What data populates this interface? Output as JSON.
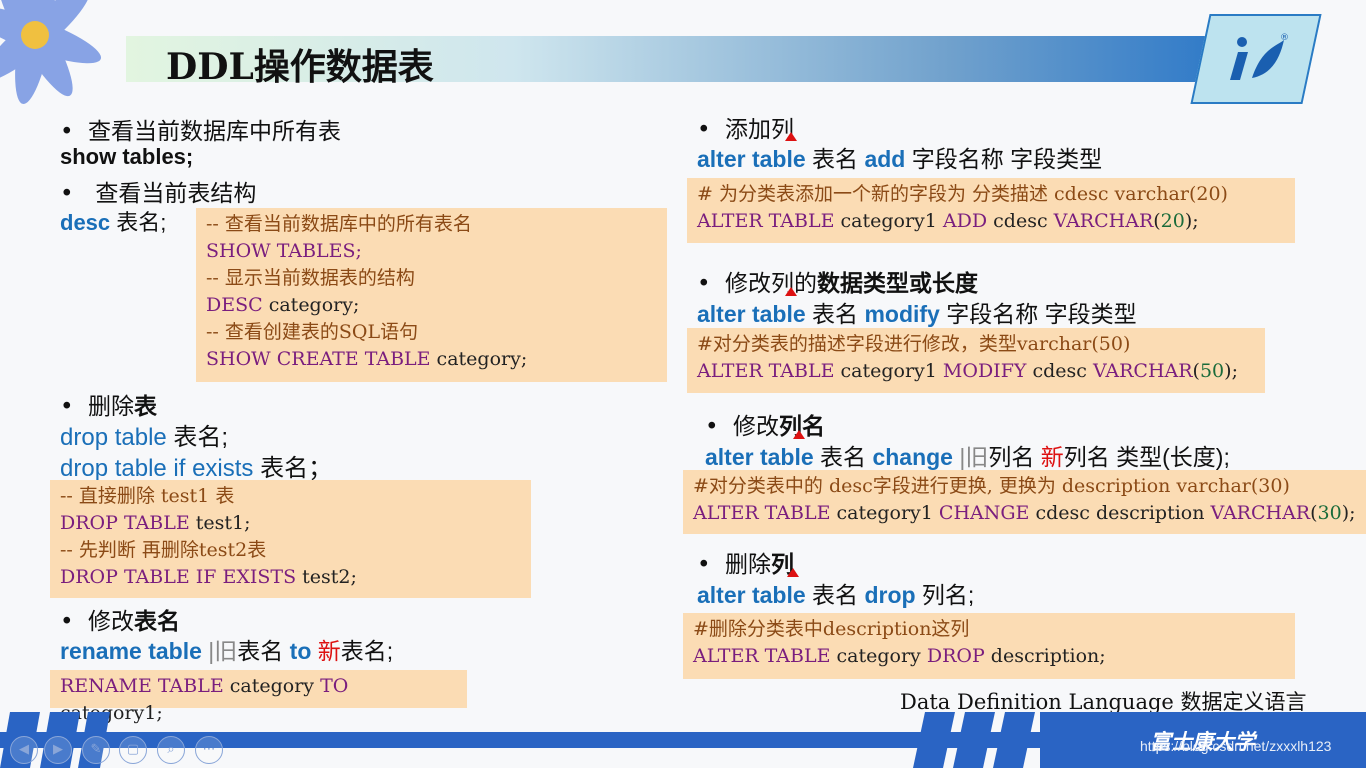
{
  "title": "DDL操作数据表",
  "left": {
    "show_tables": {
      "heading": "查看当前数据库中所有表",
      "syntax": "show tables;"
    },
    "desc": {
      "heading": "查看当前表结构",
      "syntax_kw": "desc",
      "syntax_rest": " 表名;"
    },
    "box1": [
      {
        "cls": "c-cmt",
        "text": "-- 查看当前数据库中的所有表名"
      },
      {
        "cls": "c-kw",
        "text": "SHOW TABLES;"
      },
      {
        "cls": "c-cmt",
        "text": "-- 显示当前数据表的结构"
      },
      {
        "kw": "DESC",
        "id": " category;"
      },
      {
        "cls": "c-cmt",
        "text": "-- 查看创建表的SQL语句"
      },
      {
        "kw": "SHOW CREATE TABLE",
        "id": " category;"
      }
    ],
    "drop": {
      "heading_a": "删除",
      "heading_b": "表",
      "line1_kw": "drop table",
      "line1_rest": " 表名;",
      "line2_kw": "drop table if exists",
      "line2_rest": " 表名；"
    },
    "box2": [
      {
        "cmt": "-- 直接删除 ",
        "id": "test1",
        "cmt2": " 表"
      },
      {
        "kw": "DROP TABLE",
        "id": " test1;"
      },
      {
        "cmt": "-- 先判断 再删除",
        "id": "test2",
        "cmt2": "表"
      },
      {
        "kw": "DROP TABLE IF EXISTS",
        "id": " test2;"
      }
    ],
    "rename": {
      "heading_a": "修改",
      "heading_b": "表名",
      "kw1": "rename table",
      "old": "旧",
      "t1": "表名 ",
      "kw2": "to",
      "new": "新",
      "t2": "表名;"
    },
    "box3": {
      "kw1": "RENAME TABLE",
      "id1": " category ",
      "kw2": "TO",
      "id2": " category1;"
    }
  },
  "right": {
    "add": {
      "heading": "添加列",
      "kw1": "alter table",
      "t1": " 表名  ",
      "kw2": "add",
      "t2": "  字段名称 字段类型",
      "cmt": "# 为分类表添加一个新的字段为 分类描述 cdesc varchar(20)",
      "code_kw1": "ALTER TABLE",
      "code_id1": " category1 ",
      "code_kw2": "ADD",
      "code_id2": " cdesc ",
      "code_kw3": "VARCHAR",
      "code_p1": "(",
      "code_num": "20",
      "code_p2": ");"
    },
    "modify": {
      "heading_a": "修改列的",
      "heading_b": "数据类型或长度",
      "kw1": "alter table",
      "t1": " 表名 ",
      "kw2": "modify",
      "t2": " 字段名称 字段类型",
      "cmt": "#对分类表的描述字段进行修改，类型varchar(50)",
      "code_kw1": "ALTER TABLE",
      "code_id1": " category1 ",
      "code_kw2": "MODIFY",
      "code_id2": " cdesc ",
      "code_kw3": "VARCHAR",
      "code_p1": "(",
      "code_num": "50",
      "code_p2": ");"
    },
    "change": {
      "heading_a": "修改",
      "heading_b": "列名",
      "kw1": "alter table",
      "t1": " 表名 ",
      "kw2": "change",
      "old": "旧",
      "t2": "列名 ",
      "new": "新",
      "t3": "列名 类型(长度);",
      "cmt": "#对分类表中的 desc字段进行更换, 更换为 description varchar(30)",
      "code_kw1": "ALTER TABLE",
      "code_id1": " category1 ",
      "code_kw2": "CHANGE",
      "code_id2": " cdesc description ",
      "code_kw3": "VARCHAR",
      "code_p1": "(",
      "code_num": "30",
      "code_p2": ");"
    },
    "dropcol": {
      "heading_a": "删除",
      "heading_b": "列",
      "kw1": "alter table",
      "t1": " 表名 ",
      "kw2": "drop",
      "t2": " 列名;",
      "cmt": "#删除分类表中description这列",
      "code_kw1": "ALTER TABLE",
      "code_id1": " category ",
      "code_kw2": "DROP",
      "code_id2": " description;"
    }
  },
  "note": "Data Definition Language 数据定义语言",
  "footer": {
    "school": "富士康大学",
    "watermark": "https://blog.csdn.net/zxxxlh123",
    "nav": [
      "◀",
      "▶",
      "✎",
      "▢",
      "⌕",
      "⋯"
    ]
  },
  "colors": {
    "keyword_blue": "#1a6fb8",
    "code_bg": "#fbdcb4",
    "accent_red": "#d11"
  }
}
